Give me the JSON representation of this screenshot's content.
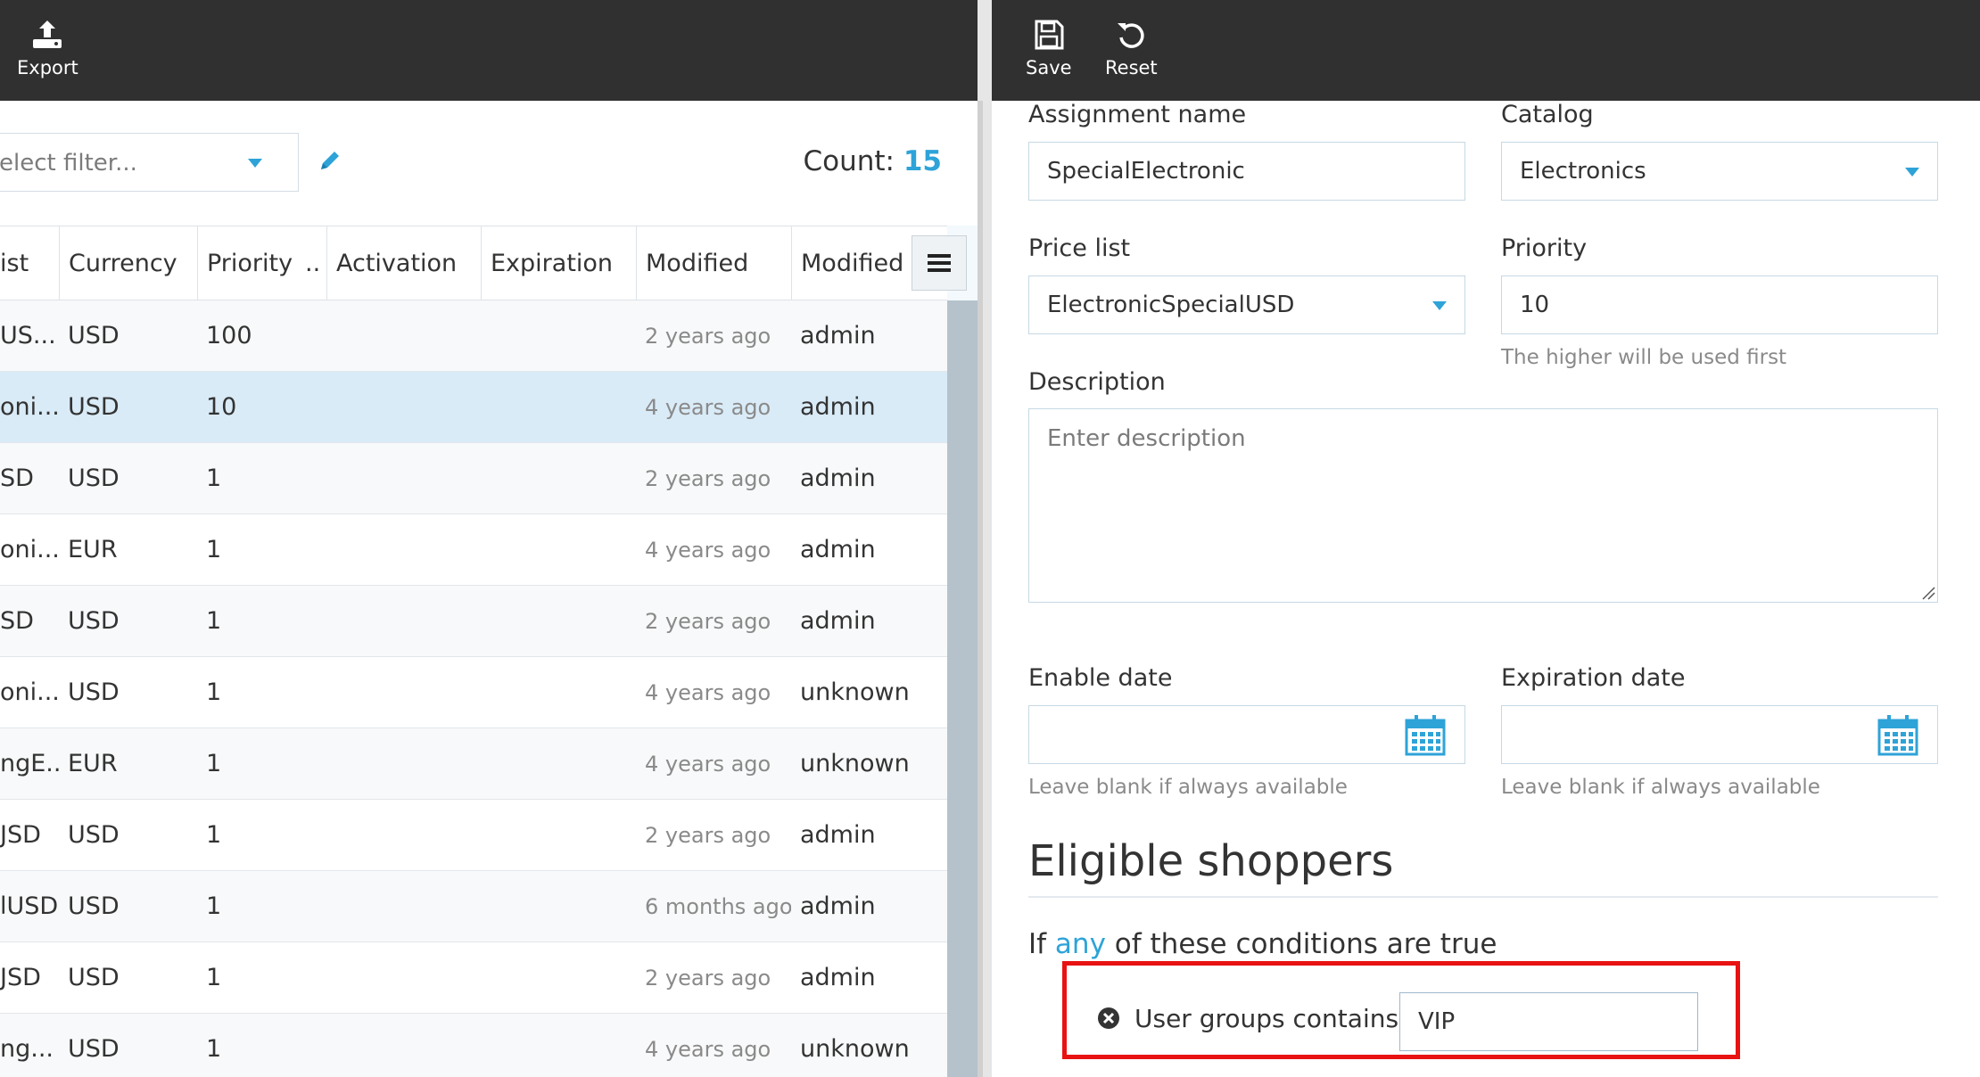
{
  "toolbar_left": {
    "export_label": "Export"
  },
  "toolbar_right": {
    "save_label": "Save",
    "reset_label": "Reset"
  },
  "filter": {
    "placeholder": "elect filter...",
    "count_label": "Count:",
    "count_value": "15"
  },
  "grid": {
    "columns": [
      "ist",
      "Currency",
      "Priority",
      "..",
      "Activation",
      "Expiration",
      "Modified",
      "Modified b"
    ],
    "rows": [
      {
        "list": "US...",
        "currency": "USD",
        "priority": "100",
        "modified": "2 years ago",
        "modified_by": "admin"
      },
      {
        "list": "oni...",
        "currency": "USD",
        "priority": "10",
        "modified": "4 years ago",
        "modified_by": "admin"
      },
      {
        "list": "SD",
        "currency": "USD",
        "priority": "1",
        "modified": "2 years ago",
        "modified_by": "admin"
      },
      {
        "list": "oni...",
        "currency": "EUR",
        "priority": "1",
        "modified": "4 years ago",
        "modified_by": "admin"
      },
      {
        "list": "SD",
        "currency": "USD",
        "priority": "1",
        "modified": "2 years ago",
        "modified_by": "admin"
      },
      {
        "list": "oni...",
        "currency": "USD",
        "priority": "1",
        "modified": "4 years ago",
        "modified_by": "unknown"
      },
      {
        "list": "ngE...",
        "currency": "EUR",
        "priority": "1",
        "modified": "4 years ago",
        "modified_by": "unknown"
      },
      {
        "list": "JSD",
        "currency": "USD",
        "priority": "1",
        "modified": "2 years ago",
        "modified_by": "admin"
      },
      {
        "list": "lUSD",
        "currency": "USD",
        "priority": "1",
        "modified": "6 months ago",
        "modified_by": "admin"
      },
      {
        "list": "JSD",
        "currency": "USD",
        "priority": "1",
        "modified": "2 years ago",
        "modified_by": "admin"
      },
      {
        "list": "ng...",
        "currency": "USD",
        "priority": "1",
        "modified": "4 years ago",
        "modified_by": "unknown"
      }
    ]
  },
  "form": {
    "assignment_name_label": "Assignment name",
    "assignment_name_value": "SpecialElectronic",
    "catalog_label": "Catalog",
    "catalog_value": "Electronics",
    "price_list_label": "Price list",
    "price_list_value": "ElectronicSpecialUSD",
    "priority_label": "Priority",
    "priority_value": "10",
    "priority_hint": "The higher will be used first",
    "description_label": "Description",
    "description_placeholder": "Enter description",
    "enable_date_label": "Enable date",
    "enable_date_hint": "Leave blank if always available",
    "expiration_date_label": "Expiration date",
    "expiration_date_hint": "Leave blank if always available"
  },
  "eligible": {
    "title": "Eligible shoppers",
    "cond_prefix": "If",
    "cond_any": "any",
    "cond_suffix": "of these conditions are true",
    "condition_text": "User groups contains",
    "condition_value": "VIP"
  },
  "colors": {
    "accent": "#2ea3d8",
    "toolbar": "#303030",
    "selected_row": "#d9ebf7",
    "highlight": "#e81212"
  }
}
